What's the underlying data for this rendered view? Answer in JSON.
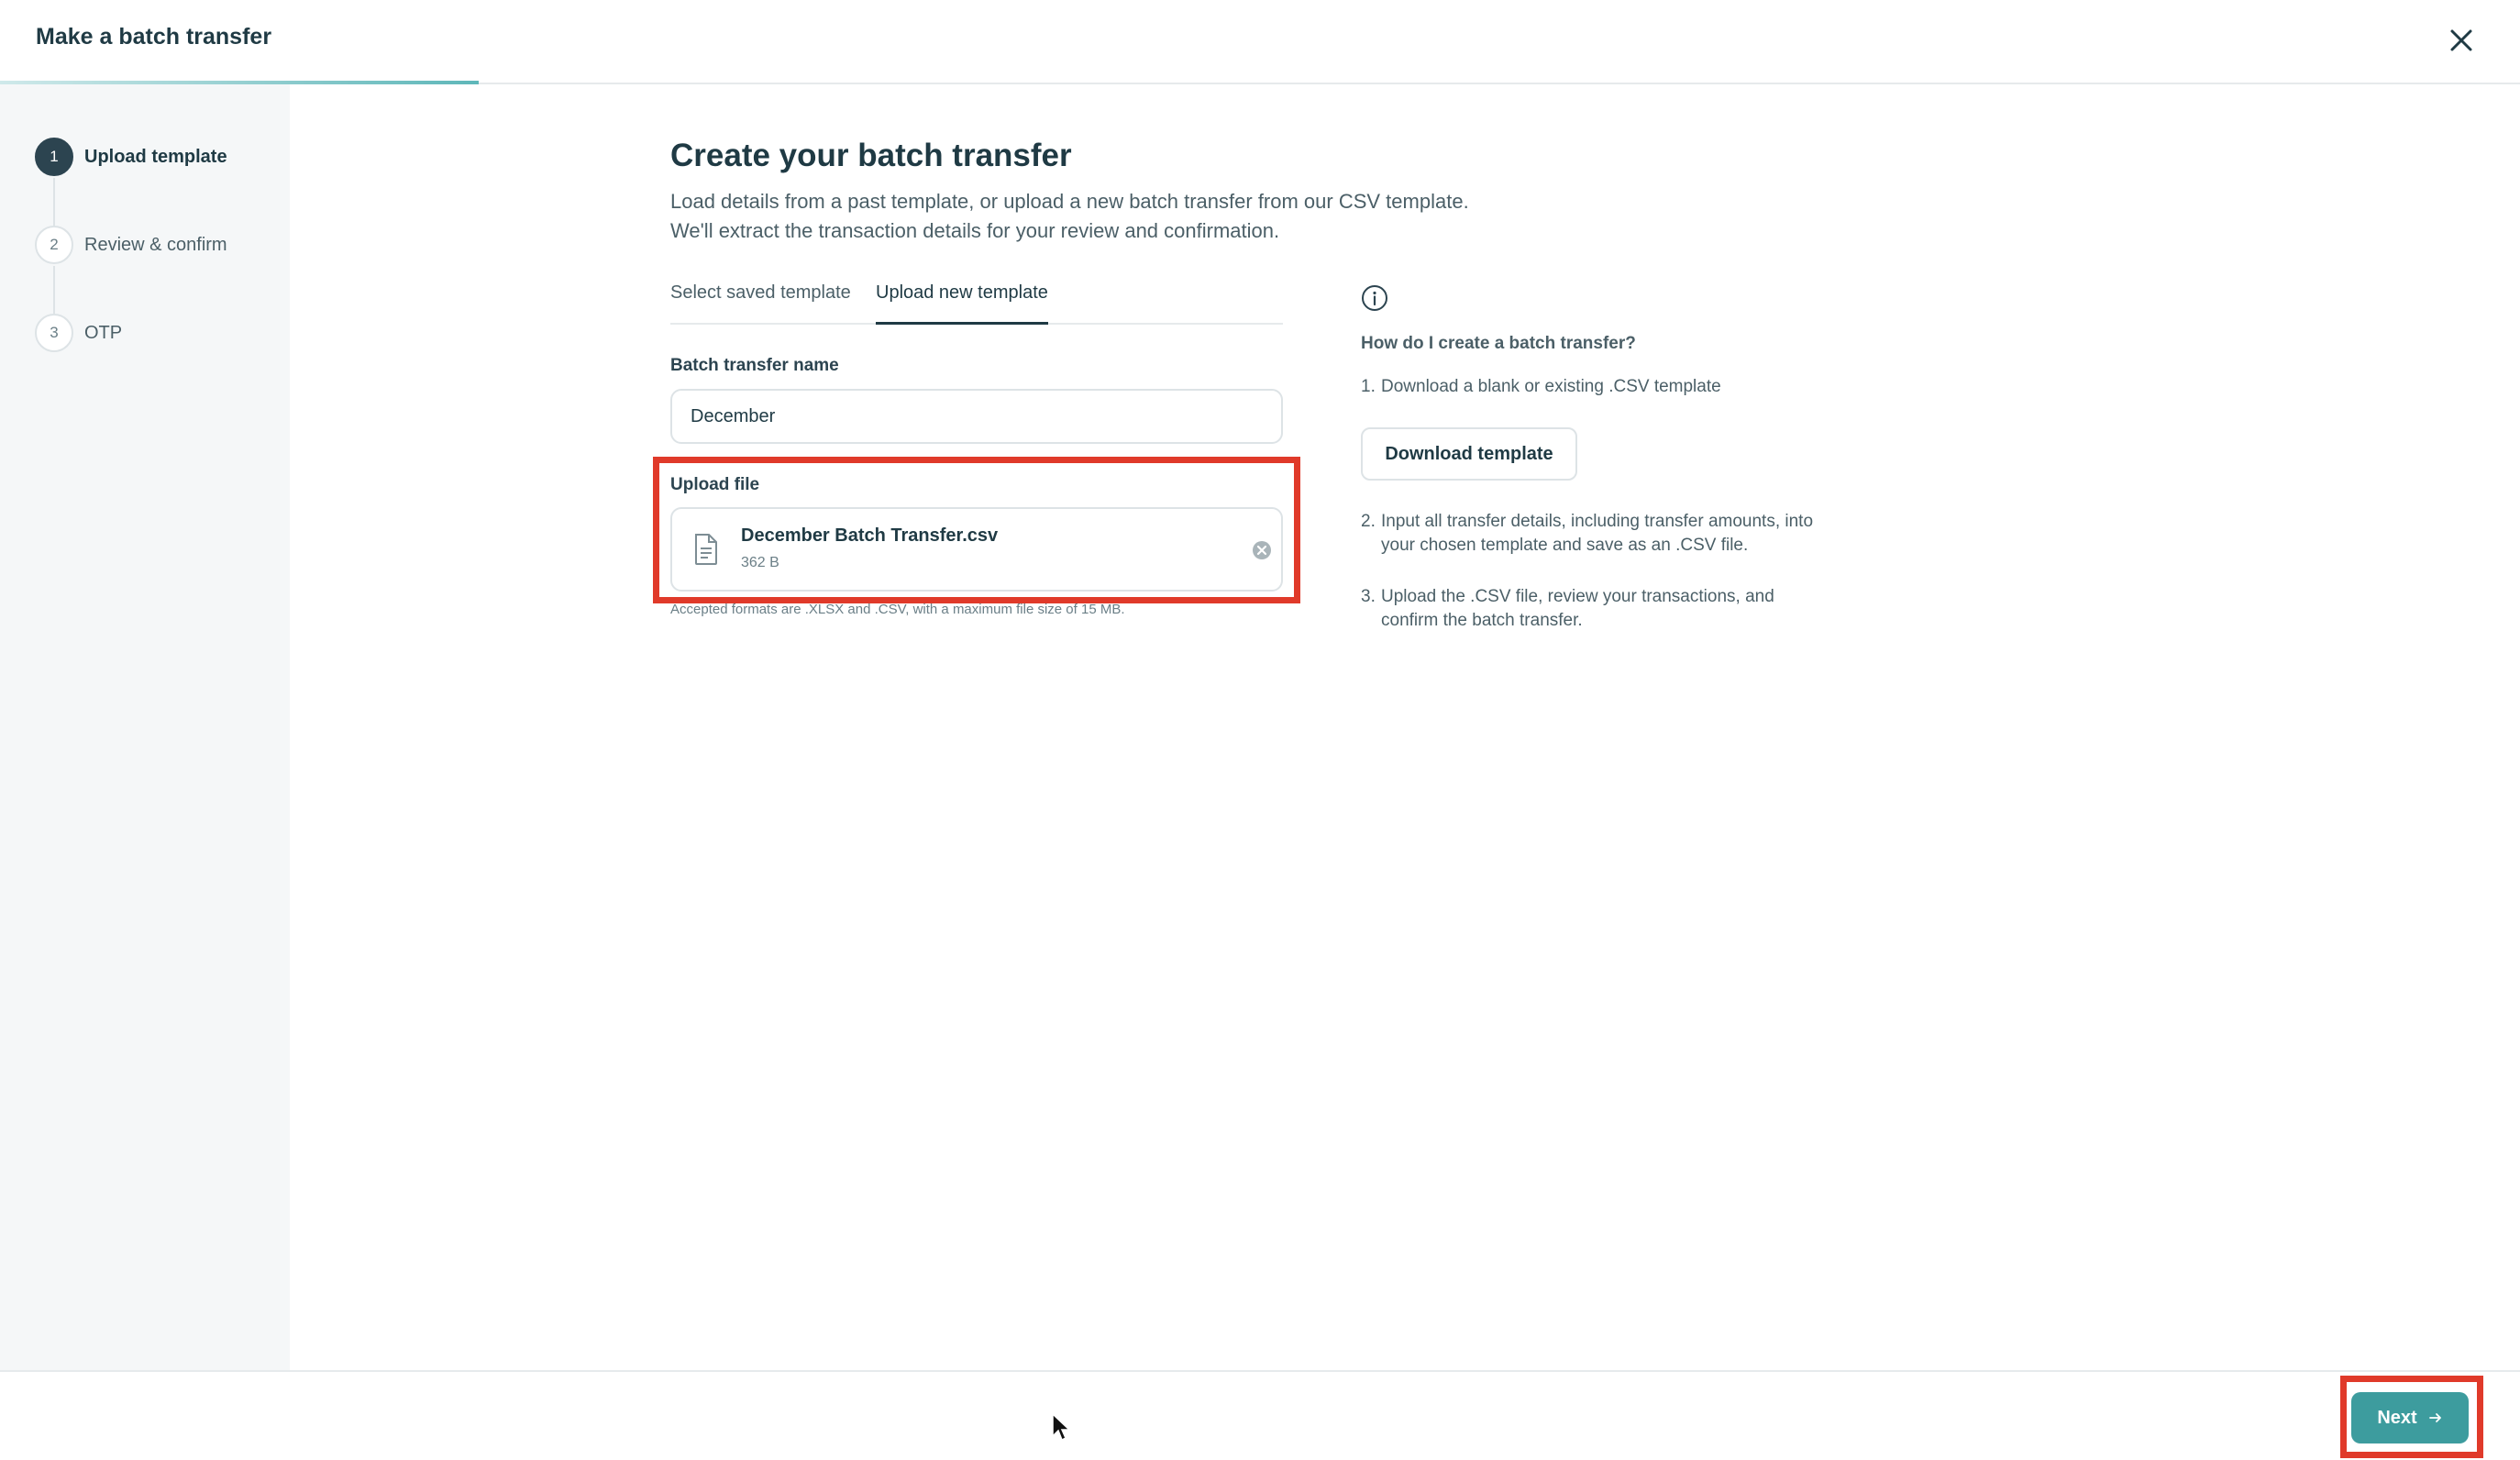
{
  "header": {
    "title": "Make a batch transfer",
    "progress": 0.19
  },
  "sidebar": {
    "steps": [
      {
        "number": "1",
        "label": "Upload template",
        "active": true
      },
      {
        "number": "2",
        "label": "Review & confirm",
        "active": false
      },
      {
        "number": "3",
        "label": "OTP",
        "active": false
      }
    ]
  },
  "main": {
    "title": "Create your batch transfer",
    "description_line1": "Load details from a past template, or upload a new batch transfer from our CSV template.",
    "description_line2": "We'll extract the transaction details for your review and confirmation.",
    "tabs": [
      {
        "label": "Select saved template",
        "active": false
      },
      {
        "label": "Upload new template",
        "active": true
      }
    ],
    "name_field": {
      "label": "Batch transfer name",
      "value": "December"
    },
    "upload": {
      "label": "Upload file",
      "file_name": "December Batch Transfer.csv",
      "file_size": "362 B",
      "hint": "Accepted formats are .XLSX and .CSV, with a maximum file size of 15 MB."
    }
  },
  "help": {
    "title": "How do I create a batch transfer?",
    "step1_num": "1.",
    "step1": "Download a blank or existing .CSV template",
    "download_button": "Download template",
    "step2_num": "2.",
    "step2": "Input all transfer details, including transfer amounts, into your chosen template and save as an .CSV file.",
    "step3_num": "3.",
    "step3": "Upload the .CSV file, review your transactions, and confirm the batch transfer."
  },
  "footer": {
    "next_label": "Next"
  },
  "colors": {
    "accent": "#3d9c9e",
    "highlight": "#e03a2a",
    "active_step": "#2c4450"
  },
  "icons": [
    "close-icon",
    "file-icon",
    "remove-file-icon",
    "info-icon",
    "arrow-right-icon",
    "mouse-cursor-icon"
  ]
}
